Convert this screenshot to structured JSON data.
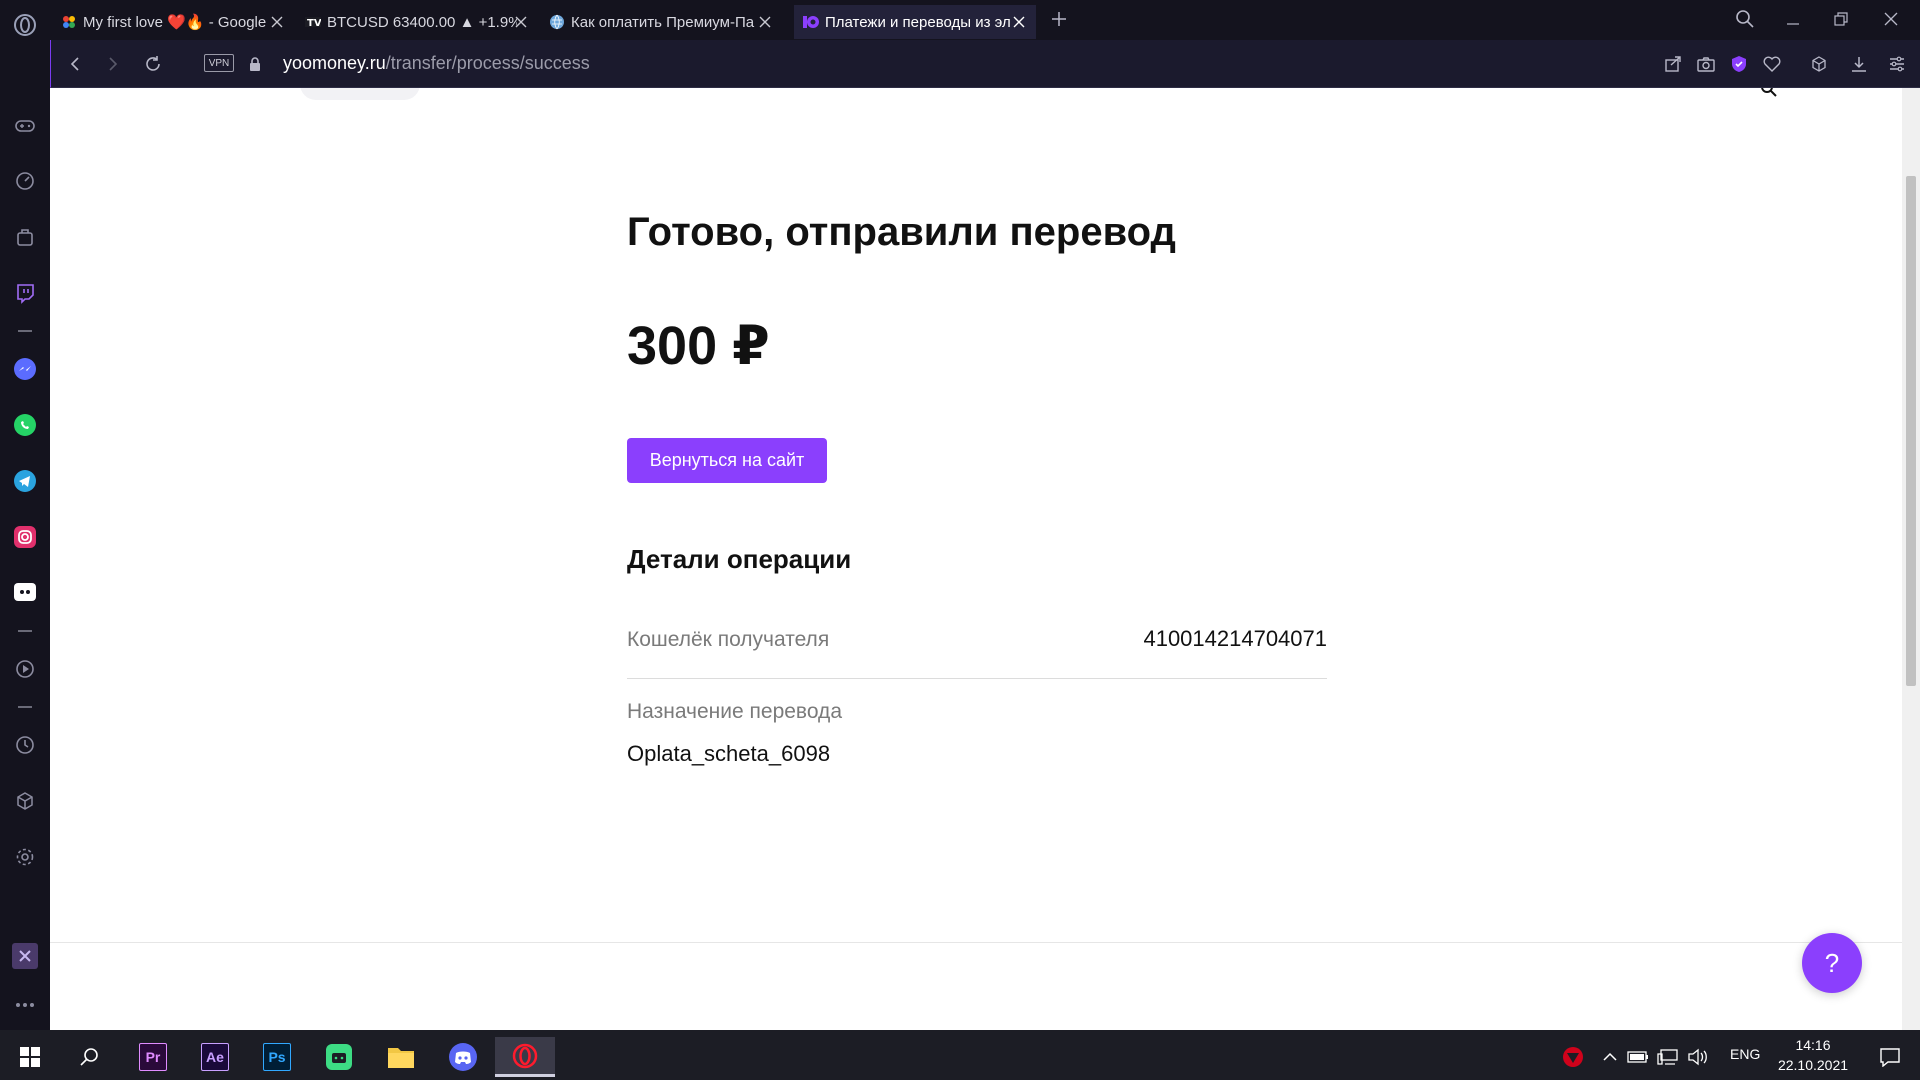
{
  "browser": {
    "tabs": [
      {
        "title": "My first love ❤️🔥 - Google",
        "active": false
      },
      {
        "title": "BTCUSD 63400.00 ▲ +1.9%",
        "active": false
      },
      {
        "title": "Как оплатить Премиум-Па",
        "active": false
      },
      {
        "title": "Платежи и переводы из эл",
        "active": true
      }
    ],
    "url_host": "yoomoney.ru",
    "url_path": "/transfer/process/success",
    "vpn_label": "VPN"
  },
  "page": {
    "title": "Готово, отправили перевод",
    "amount": "300 ₽",
    "back_button_label": "Вернуться на сайт",
    "details_title": "Детали операции",
    "details": {
      "wallet_label": "Кошелёк получателя",
      "wallet_value": "410014214704071",
      "purpose_label": "Назначение перевода",
      "purpose_value": "Oplata_scheta_6098"
    },
    "help_label": "?"
  },
  "taskbar": {
    "apps": [
      "Pr",
      "Ae",
      "Ps"
    ],
    "language": "ENG",
    "time": "14:16",
    "date": "22.10.2021"
  },
  "colors": {
    "accent": "#8b3ffd",
    "browser_bg": "#14131e"
  }
}
